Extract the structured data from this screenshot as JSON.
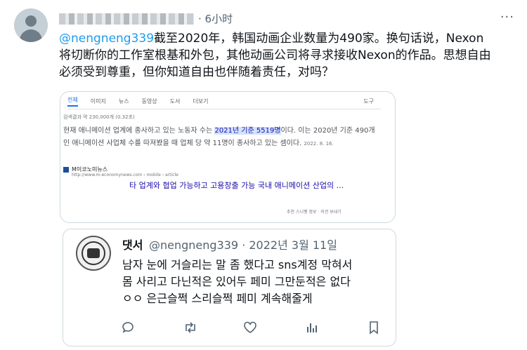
{
  "tweet": {
    "time": "· 6小时",
    "mention": "@nengneng339",
    "text_after_mention": "截至2020年，韩国动画企业数量为490家。换句话说，Nexon将切断你的工作室根基和外包，其他动画公司将寻求接收Nexon的作品。思想自由必须受到尊重，但你知道自由也伴随着责任，对吗？",
    "more_label": "···"
  },
  "search_card": {
    "tabs": [
      "전체",
      "이미지",
      "뉴스",
      "동영상",
      "도서",
      "더보기"
    ],
    "tool_label": "도구",
    "stats": "검색결과 약 230,000개 (0.32초)",
    "snippet_pre": "현재 애니메이션 업계에 종사하고 있는 노동자 수는 ",
    "snippet_highlight": "2021년 기준 5519명",
    "snippet_post": "이다. 이는 2020년 기준 490개인 애니메이션 사업체 수를 따져봤을 때 업체 당 약 11명이 종사하고 있는 셈이다.",
    "snippet_date": "2022. 8. 16.",
    "source_name": "M이코노미뉴스",
    "source_url": "http://www.m-economynews.com › mobile › article",
    "link_title": "타 업계와 협업 가능하고 고용창출 가능 국내 애니메이션 산업의 ...",
    "footer_label": "추천 스니펫 정보 · 의견 보내기"
  },
  "quoted": {
    "name": "댓서",
    "handle": "@nengneng339 · 2022년 3월 11일",
    "lines": [
      "남자 눈에 거슬리는 말 좀 했다고 sns계정 막혀서",
      "몸 사리고 다닌적은 있어두 페미 그만둔적은 없다",
      "ㅇㅇ 은근슬쩍 스리슬쩍 페미 계속해줄게"
    ]
  },
  "actions": [
    "reply-icon",
    "retweet-icon",
    "like-icon",
    "views-icon",
    "bookmark-icon"
  ],
  "colors": {
    "link_blue": "#1d9bf0",
    "search_link": "#1a0dab",
    "muted": "#536471"
  }
}
